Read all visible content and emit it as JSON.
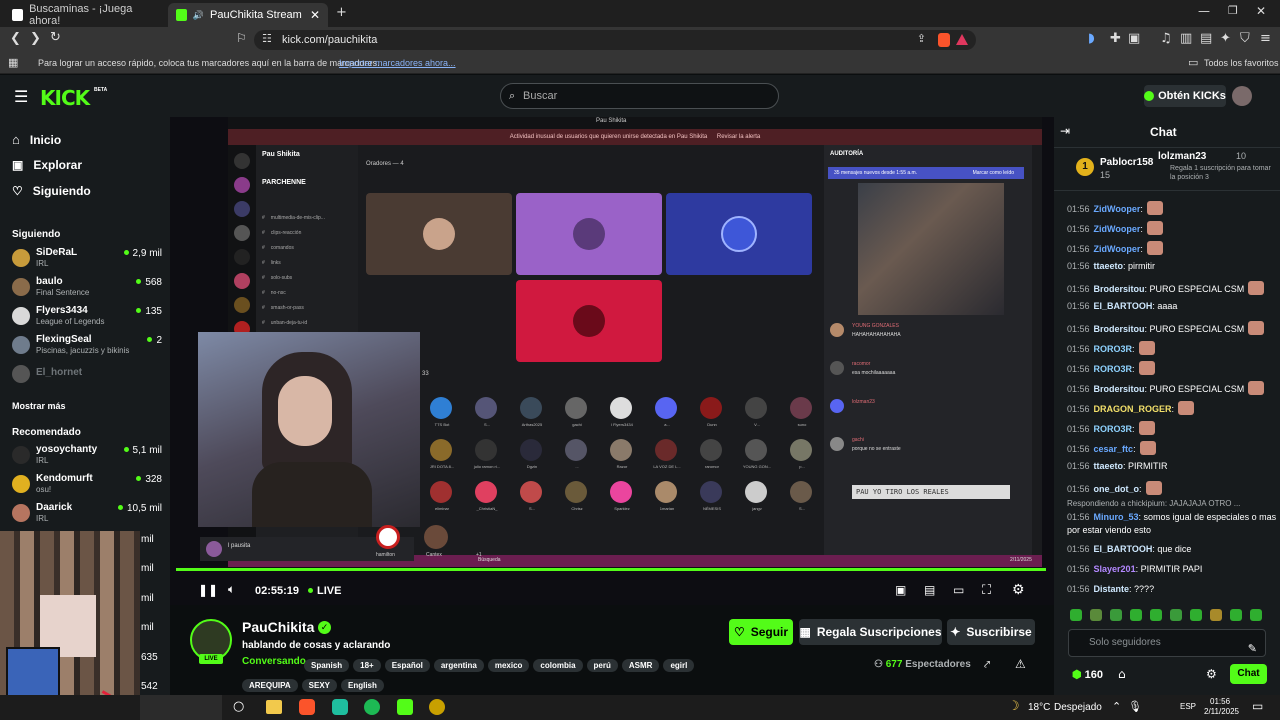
{
  "browser": {
    "tabs": [
      {
        "title": "Buscaminas - ¡Juega ahora!"
      },
      {
        "title": "PauChikita Stream - Watch Li..."
      }
    ],
    "url": "kick.com/pauchikita",
    "bookmarks_bar": {
      "prompt": "Para lograr un acceso rápido, coloca tus marcadores aquí en la barra de marcadores.",
      "import_link": "Importar marcadores ahora...",
      "all_favorites": "Todos los favoritos"
    }
  },
  "header": {
    "logo": "KICK",
    "beta": "BETA",
    "search_placeholder": "Buscar",
    "obten_label": "Obtén KICKs"
  },
  "sidebar": {
    "nav": [
      {
        "label": "Inicio",
        "icon": "home-icon"
      },
      {
        "label": "Explorar",
        "icon": "compass-icon"
      },
      {
        "label": "Siguiendo",
        "icon": "heart-icon"
      }
    ],
    "following_title": "Siguiendo",
    "following": [
      {
        "name": "SiDeRaL",
        "game": "IRL",
        "viewers": "2,9 mil",
        "color": "#c79b3b"
      },
      {
        "name": "baulo",
        "game": "Final Sentence",
        "viewers": "568",
        "color": "#8a6b4a"
      },
      {
        "name": "Flyers3434",
        "game": "League of Legends",
        "viewers": "135",
        "color": "#d9d9d9"
      },
      {
        "name": "FlexingSeal",
        "game": "Piscinas, jacuzzis y bikinis",
        "viewers": "2",
        "color": "#6f7c8c"
      },
      {
        "name": "El_hornet",
        "game": "",
        "viewers": "",
        "color": "#555"
      }
    ],
    "show_more": "Mostrar más",
    "recommended_title": "Recomendado",
    "recommended": [
      {
        "name": "yosoychanty",
        "game": "IRL",
        "viewers": "5,1 mil",
        "color": "#2a2a2a"
      },
      {
        "name": "Kendomurft",
        "game": "osu!",
        "viewers": "328",
        "color": "#e0b020"
      },
      {
        "name": "Daarick",
        "game": "IRL",
        "viewers": "10,5 mil",
        "color": "#b67560"
      }
    ],
    "partial_counts": [
      "mil",
      "mil",
      "mil",
      "mil",
      "635",
      "542"
    ]
  },
  "video": {
    "time": "02:55:19",
    "live": "LIVE",
    "discord": {
      "server": "Pau Shikita",
      "channel_title": "PARCHENNE",
      "channels": [
        "multimedia-de-mis-clip...",
        "clips-reacción",
        "comandos",
        "links",
        "solo-subs",
        "no-nsc",
        "smash-or-pass",
        "unban-deja-tu-id"
      ],
      "speakers_label": "Oradores — 4",
      "alert": "Actividad inusual de usuarios que quieren unirse detectada en Pau Shikita",
      "alert_action": "Revisar la alerta",
      "audience_label": "33",
      "audience": [
        "TTS Bot",
        "S...",
        "Arthas2025",
        "gachi",
        "l Flyers3434",
        "a...",
        "Dunn",
        "V...",
        "suno",
        "JRI DOTA 8...",
        "julio ramon ri...",
        "Dgzin",
        "...",
        "Razor",
        "LA VOZ DE L...",
        "raromor",
        "YOUNG GON...",
        "p...",
        "eliminar",
        "_ChristiaN_",
        "S...",
        "Chrisz",
        "Sparklez",
        "1marian",
        "NÉMESIS",
        "jangv",
        "S..."
      ],
      "bottom_user": "l pausita",
      "bottom_hamilton": "hamilton",
      "bottom_cantex": "Cantex",
      "bottom_plus": "+1",
      "chat_title": "AUDITORÍA",
      "chat_banner": "35 mensajes nuevos desde 1:55 a.m.",
      "chat_banner_action": "Marcar como leído",
      "chat_lines": [
        {
          "user": "YOUNG GONZALES",
          "text": "HAHAHAHAHAHAHA"
        },
        {
          "user": "racomor",
          "text": "esa mochilaaaaaaa"
        },
        {
          "user": "lolzman23",
          "text": ""
        },
        {
          "user": "gachi",
          "text": "porque no se entraste"
        }
      ],
      "overlay_text": "PAU YO TIRO LOS REALES",
      "taskbar_search": "Búsqueda",
      "clock": "2/11/2025"
    },
    "webcam_label": "l pausita"
  },
  "chat": {
    "title": "Chat",
    "pinned": [
      {
        "user": "Pablocr158",
        "count": "15"
      },
      {
        "user": "lolzman23",
        "count": "10",
        "text": "Regala 1 suscripción para tomar la posición 3"
      }
    ],
    "messages": [
      {
        "time": "01:56",
        "user": "ZidWooper",
        "text": ":",
        "color": "#6aa9ff",
        "emote": true
      },
      {
        "time": "01:56",
        "user": "ZidWooper",
        "text": ":",
        "color": "#6aa9ff",
        "emote": true
      },
      {
        "time": "01:56",
        "user": "ZidWooper",
        "text": ":",
        "color": "#6aa9ff",
        "emote": true
      },
      {
        "time": "01:56",
        "user": "ttaeeto",
        "text": ": pirmitir",
        "color": "#cfe9ff"
      },
      {
        "time": "01:56",
        "user": "Brodersitou",
        "text": ": PURO ESPECIAL CSM",
        "color": "#cfe9ff",
        "emote": true
      },
      {
        "time": "01:56",
        "user": "El_BARTOOH",
        "text": ": aaaa",
        "color": "#cfe9ff"
      },
      {
        "time": "01:56",
        "user": "Brodersitou",
        "text": ": PURO ESPECIAL CSM",
        "color": "#cfe9ff",
        "emote": true
      },
      {
        "time": "01:56",
        "user": "RORO3R",
        "text": ":",
        "color": "#8fd3ff",
        "emote": true
      },
      {
        "time": "01:56",
        "user": "RORO3R",
        "text": ":",
        "color": "#8fd3ff",
        "emote": true
      },
      {
        "time": "01:56",
        "user": "Brodersitou",
        "text": ": PURO ESPECIAL CSM",
        "color": "#cfe9ff",
        "emote": true
      },
      {
        "time": "01:56",
        "user": "DRAGON_ROGER",
        "text": ":",
        "color": "#f3e06a",
        "emote": true
      },
      {
        "time": "01:56",
        "user": "RORO3R",
        "text": ":",
        "color": "#8fd3ff",
        "emote": true
      },
      {
        "time": "01:56",
        "user": "cesar_ftc",
        "text": ":",
        "color": "#6aa9ff",
        "emote": true
      },
      {
        "time": "01:56",
        "user": "ttaeeto",
        "text": ": PIRMITIR",
        "color": "#cfe9ff"
      },
      {
        "time": "01:56",
        "user": "one_dot_o",
        "text": ":",
        "color": "#cfe9ff",
        "emote": true
      }
    ],
    "reply_to": "Respondiendo a chickipium: JAJAJAJA OTRO ...",
    "reply_msg": {
      "time": "01:56",
      "user": "Minuro_53",
      "text": ": somos igual de especiales o mas por estar viendo esto",
      "color": "#6aa9ff"
    },
    "after": [
      {
        "time": "01:56",
        "user": "El_BARTOOH",
        "text": ": que dice",
        "color": "#cfe9ff"
      },
      {
        "time": "01:56",
        "user": "Slayer201",
        "text": ": PIRMITIR PAPI",
        "color": "#b388ff"
      },
      {
        "time": "01:56",
        "user": "Distante",
        "text": ": ????",
        "color": "#cfe9ff"
      }
    ],
    "input_placeholder": "Solo seguidores",
    "points": "160",
    "send_label": "Chat"
  },
  "streamer": {
    "name": "PauChikita",
    "title": "hablando de cosas y aclarando",
    "category": "Conversando",
    "tags": [
      "Spanish",
      "18+",
      "Español",
      "argentina",
      "mexico",
      "colombia",
      "perú",
      "ASMR",
      "egirl"
    ],
    "tags2": [
      "AREQUIPA",
      "SEXY",
      "English"
    ],
    "live_badge": "LIVE",
    "follow_label": "Seguir",
    "gift_label": "Regala Suscripciones",
    "subscribe_label": "Suscribirse",
    "viewers": "677",
    "viewers_label": "Espectadores"
  },
  "taskbar": {
    "weather": "18°C",
    "weather_desc": "Despejado",
    "lang": "ESP",
    "time": "01:56",
    "date": "2/11/2025",
    "notif": "3"
  },
  "colors": {
    "kick_green": "#53fc18",
    "bg": "#0b0e0f",
    "panel": "#171b1d"
  }
}
